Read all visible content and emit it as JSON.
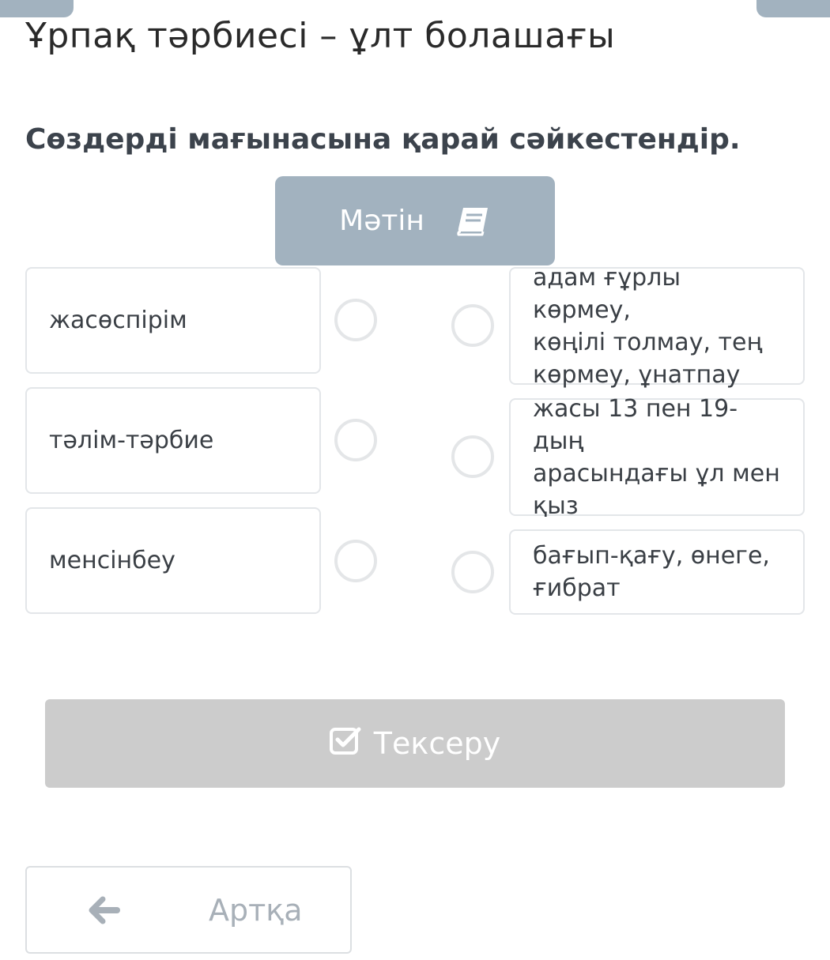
{
  "header": {
    "title": "Ұрпақ тәрбиесі – ұлт болашағы"
  },
  "task": {
    "instruction": "Сөздерді мағынасына қарай сәйкестендір.",
    "text_button_label": "Мәтін"
  },
  "left_items": [
    {
      "label": "жасөспірім"
    },
    {
      "label": "тәлім-тәрбие"
    },
    {
      "label": "менсінбеу"
    }
  ],
  "right_items": [
    {
      "line1": "адам ғұрлы көрмеу,",
      "line2": "көңілі толмау, тең",
      "line3": "көрмеу, ұнатпау"
    },
    {
      "line1": "жасы 13 пен 19-дың",
      "line2": "арасындағы ұл мен",
      "line3": "қыз"
    },
    {
      "line1": "бағып-қағу, өнеге,",
      "line2": "ғибрат"
    }
  ],
  "actions": {
    "check_label": "Тексеру",
    "back_label": "Артқа"
  },
  "icons": {
    "text": "book-icon",
    "check": "checkbox-icon",
    "back": "arrow-left-icon"
  },
  "colors": {
    "accent": "#a2b2bf",
    "disabled": "#cccccc",
    "border": "#e3e6e9"
  }
}
